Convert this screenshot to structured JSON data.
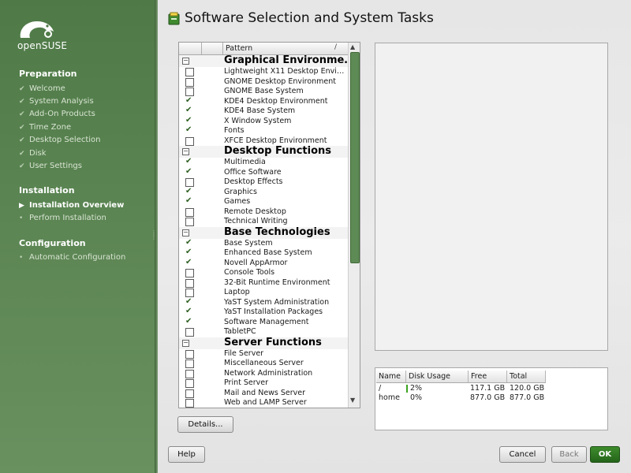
{
  "sidebar": {
    "logo_text": "openSUSE",
    "sections": [
      {
        "title": "Preparation",
        "steps": [
          {
            "label": "Welcome",
            "state": "done"
          },
          {
            "label": "System Analysis",
            "state": "done"
          },
          {
            "label": "Add-On Products",
            "state": "done"
          },
          {
            "label": "Time Zone",
            "state": "done"
          },
          {
            "label": "Desktop Selection",
            "state": "done"
          },
          {
            "label": "Disk",
            "state": "done"
          },
          {
            "label": "User Settings",
            "state": "done"
          }
        ]
      },
      {
        "title": "Installation",
        "steps": [
          {
            "label": "Installation Overview",
            "state": "current"
          },
          {
            "label": "Perform Installation",
            "state": "pending"
          }
        ]
      },
      {
        "title": "Configuration",
        "steps": [
          {
            "label": "Automatic Configuration",
            "state": "pending"
          }
        ]
      }
    ]
  },
  "header": {
    "title": "Software Selection and System Tasks"
  },
  "patterns": {
    "column_header": "Pattern",
    "sort_indicator": "/",
    "rows": [
      {
        "type": "category",
        "label": "Graphical Environme…",
        "marker": "−"
      },
      {
        "type": "item",
        "label": "Lightweight X11 Desktop Envi…",
        "checked": false
      },
      {
        "type": "item",
        "label": "GNOME Desktop Environment",
        "checked": false
      },
      {
        "type": "item",
        "label": "GNOME Base System",
        "checked": false
      },
      {
        "type": "item",
        "label": "KDE4 Desktop Environment",
        "checked": true
      },
      {
        "type": "item",
        "label": "KDE4 Base System",
        "checked": true
      },
      {
        "type": "item",
        "label": "X Window System",
        "checked": true
      },
      {
        "type": "item",
        "label": "Fonts",
        "checked": true
      },
      {
        "type": "item",
        "label": "XFCE Desktop Environment",
        "checked": false
      },
      {
        "type": "category",
        "label": "Desktop Functions",
        "marker": "−"
      },
      {
        "type": "item",
        "label": "Multimedia",
        "checked": true
      },
      {
        "type": "item",
        "label": "Office Software",
        "checked": true
      },
      {
        "type": "item",
        "label": "Desktop Effects",
        "checked": false
      },
      {
        "type": "item",
        "label": "Graphics",
        "checked": true
      },
      {
        "type": "item",
        "label": "Games",
        "checked": true
      },
      {
        "type": "item",
        "label": "Remote Desktop",
        "checked": false
      },
      {
        "type": "item",
        "label": "Technical Writing",
        "checked": false
      },
      {
        "type": "category",
        "label": "Base Technologies",
        "marker": "−"
      },
      {
        "type": "item",
        "label": "Base System",
        "checked": true
      },
      {
        "type": "item",
        "label": "Enhanced Base System",
        "checked": true
      },
      {
        "type": "item",
        "label": "Novell AppArmor",
        "checked": true
      },
      {
        "type": "item",
        "label": "Console Tools",
        "checked": false
      },
      {
        "type": "item",
        "label": "32-Bit Runtime Environment",
        "checked": false
      },
      {
        "type": "item",
        "label": "Laptop",
        "checked": false
      },
      {
        "type": "item",
        "label": "YaST System Administration",
        "checked": true
      },
      {
        "type": "item",
        "label": "YaST Installation Packages",
        "checked": true
      },
      {
        "type": "item",
        "label": "Software Management",
        "checked": true
      },
      {
        "type": "item",
        "label": "TabletPC",
        "checked": false
      },
      {
        "type": "category",
        "label": "Server Functions",
        "marker": "−"
      },
      {
        "type": "item",
        "label": "File Server",
        "checked": false
      },
      {
        "type": "item",
        "label": "Miscellaneous Server",
        "checked": false
      },
      {
        "type": "item",
        "label": "Network Administration",
        "checked": false
      },
      {
        "type": "item",
        "label": "Print Server",
        "checked": false
      },
      {
        "type": "item",
        "label": "Mail and News Server",
        "checked": false
      },
      {
        "type": "item",
        "label": "Web and LAMP Server",
        "checked": false
      }
    ]
  },
  "disk_usage": {
    "columns": [
      "Name",
      "Disk Usage",
      "Free",
      "Total"
    ],
    "rows": [
      {
        "name": "/",
        "usage": "2%",
        "usage_fraction": 0.02,
        "free": "117.1 GB",
        "total": "120.0 GB"
      },
      {
        "name": "home",
        "usage": "0%",
        "usage_fraction": 0.0,
        "free": "877.0 GB",
        "total": "877.0 GB"
      }
    ]
  },
  "buttons": {
    "details": "Details...",
    "help": "Help",
    "cancel": "Cancel",
    "back": "Back",
    "ok": "OK"
  },
  "colors": {
    "sidebar_green": "#5b8553",
    "accent_green": "#2d7a22"
  },
  "icons": {
    "logo": "opensuse-chameleon-icon",
    "title": "software-package-icon",
    "done_step": "check-icon",
    "current_step": "triangle-right-icon",
    "pending_step": "bullet-icon"
  }
}
